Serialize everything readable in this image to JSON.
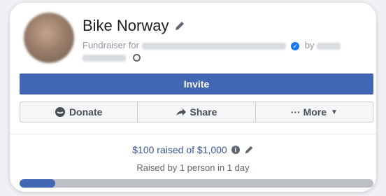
{
  "fundraiser": {
    "title": "Bike Norway",
    "fundraiser_for_label": "Fundraiser for",
    "by_label": "by",
    "verified_icon": "verified-check-icon",
    "privacy_icon": "globe-icon"
  },
  "buttons": {
    "invite": "Invite",
    "donate": "Donate",
    "share": "Share",
    "more": "··· More"
  },
  "progress": {
    "raised_text": "$100 raised of $1,000",
    "raised_by_text": "Raised by 1 person in 1 day",
    "raised_amount": 100,
    "goal_amount": 1000,
    "fraction": 0.1
  },
  "colors": {
    "brand_blue": "#4267b2",
    "link_blue": "#385898",
    "track_gray": "#bcc0c4"
  }
}
